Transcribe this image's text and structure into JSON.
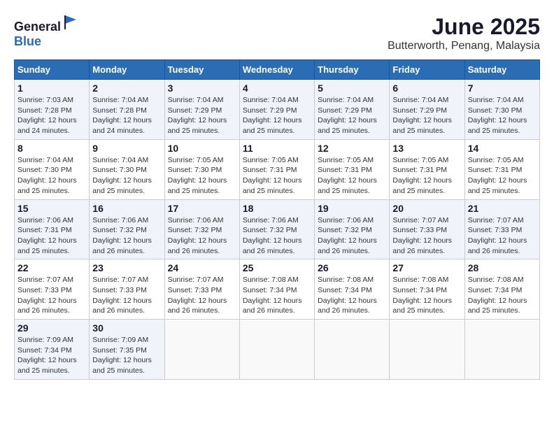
{
  "logo": {
    "text_general": "General",
    "text_blue": "Blue"
  },
  "title": "June 2025",
  "subtitle": "Butterworth, Penang, Malaysia",
  "headers": [
    "Sunday",
    "Monday",
    "Tuesday",
    "Wednesday",
    "Thursday",
    "Friday",
    "Saturday"
  ],
  "weeks": [
    [
      {
        "day": "1",
        "sunrise": "7:03 AM",
        "sunset": "7:28 PM",
        "daylight": "12 hours and 24 minutes."
      },
      {
        "day": "2",
        "sunrise": "7:04 AM",
        "sunset": "7:28 PM",
        "daylight": "12 hours and 24 minutes."
      },
      {
        "day": "3",
        "sunrise": "7:04 AM",
        "sunset": "7:29 PM",
        "daylight": "12 hours and 25 minutes."
      },
      {
        "day": "4",
        "sunrise": "7:04 AM",
        "sunset": "7:29 PM",
        "daylight": "12 hours and 25 minutes."
      },
      {
        "day": "5",
        "sunrise": "7:04 AM",
        "sunset": "7:29 PM",
        "daylight": "12 hours and 25 minutes."
      },
      {
        "day": "6",
        "sunrise": "7:04 AM",
        "sunset": "7:29 PM",
        "daylight": "12 hours and 25 minutes."
      },
      {
        "day": "7",
        "sunrise": "7:04 AM",
        "sunset": "7:30 PM",
        "daylight": "12 hours and 25 minutes."
      }
    ],
    [
      {
        "day": "8",
        "sunrise": "7:04 AM",
        "sunset": "7:30 PM",
        "daylight": "12 hours and 25 minutes."
      },
      {
        "day": "9",
        "sunrise": "7:04 AM",
        "sunset": "7:30 PM",
        "daylight": "12 hours and 25 minutes."
      },
      {
        "day": "10",
        "sunrise": "7:05 AM",
        "sunset": "7:30 PM",
        "daylight": "12 hours and 25 minutes."
      },
      {
        "day": "11",
        "sunrise": "7:05 AM",
        "sunset": "7:31 PM",
        "daylight": "12 hours and 25 minutes."
      },
      {
        "day": "12",
        "sunrise": "7:05 AM",
        "sunset": "7:31 PM",
        "daylight": "12 hours and 25 minutes."
      },
      {
        "day": "13",
        "sunrise": "7:05 AM",
        "sunset": "7:31 PM",
        "daylight": "12 hours and 25 minutes."
      },
      {
        "day": "14",
        "sunrise": "7:05 AM",
        "sunset": "7:31 PM",
        "daylight": "12 hours and 25 minutes."
      }
    ],
    [
      {
        "day": "15",
        "sunrise": "7:06 AM",
        "sunset": "7:31 PM",
        "daylight": "12 hours and 25 minutes."
      },
      {
        "day": "16",
        "sunrise": "7:06 AM",
        "sunset": "7:32 PM",
        "daylight": "12 hours and 26 minutes."
      },
      {
        "day": "17",
        "sunrise": "7:06 AM",
        "sunset": "7:32 PM",
        "daylight": "12 hours and 26 minutes."
      },
      {
        "day": "18",
        "sunrise": "7:06 AM",
        "sunset": "7:32 PM",
        "daylight": "12 hours and 26 minutes."
      },
      {
        "day": "19",
        "sunrise": "7:06 AM",
        "sunset": "7:32 PM",
        "daylight": "12 hours and 26 minutes."
      },
      {
        "day": "20",
        "sunrise": "7:07 AM",
        "sunset": "7:33 PM",
        "daylight": "12 hours and 26 minutes."
      },
      {
        "day": "21",
        "sunrise": "7:07 AM",
        "sunset": "7:33 PM",
        "daylight": "12 hours and 26 minutes."
      }
    ],
    [
      {
        "day": "22",
        "sunrise": "7:07 AM",
        "sunset": "7:33 PM",
        "daylight": "12 hours and 26 minutes."
      },
      {
        "day": "23",
        "sunrise": "7:07 AM",
        "sunset": "7:33 PM",
        "daylight": "12 hours and 26 minutes."
      },
      {
        "day": "24",
        "sunrise": "7:07 AM",
        "sunset": "7:33 PM",
        "daylight": "12 hours and 26 minutes."
      },
      {
        "day": "25",
        "sunrise": "7:08 AM",
        "sunset": "7:34 PM",
        "daylight": "12 hours and 26 minutes."
      },
      {
        "day": "26",
        "sunrise": "7:08 AM",
        "sunset": "7:34 PM",
        "daylight": "12 hours and 26 minutes."
      },
      {
        "day": "27",
        "sunrise": "7:08 AM",
        "sunset": "7:34 PM",
        "daylight": "12 hours and 25 minutes."
      },
      {
        "day": "28",
        "sunrise": "7:08 AM",
        "sunset": "7:34 PM",
        "daylight": "12 hours and 25 minutes."
      }
    ],
    [
      {
        "day": "29",
        "sunrise": "7:09 AM",
        "sunset": "7:34 PM",
        "daylight": "12 hours and 25 minutes."
      },
      {
        "day": "30",
        "sunrise": "7:09 AM",
        "sunset": "7:35 PM",
        "daylight": "12 hours and 25 minutes."
      },
      null,
      null,
      null,
      null,
      null
    ]
  ],
  "labels": {
    "sunrise": "Sunrise:",
    "sunset": "Sunset:",
    "daylight": "Daylight:"
  }
}
